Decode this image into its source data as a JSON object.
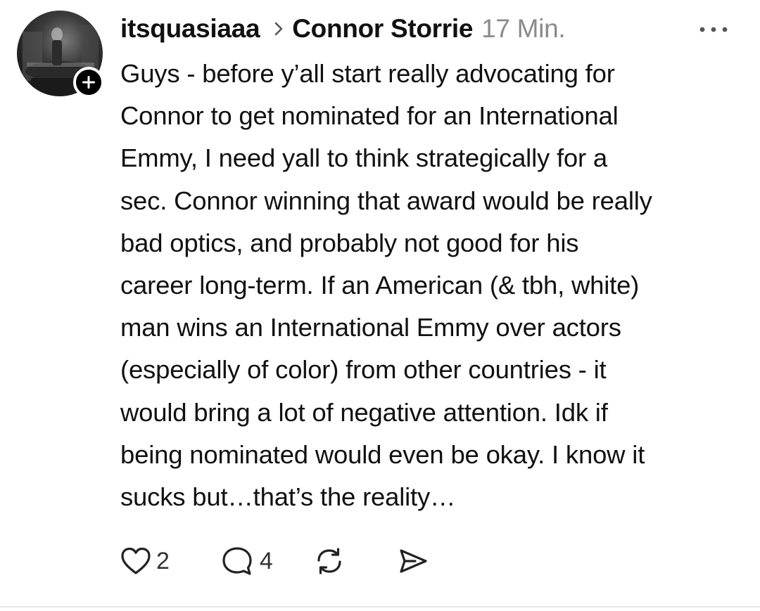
{
  "post": {
    "username": "itsquasiaaa",
    "reply_to": "Connor Storrie",
    "timestamp": "17 Min.",
    "body_lines": [
      "Guys - before y’all start really advocating for",
      "Connor to get nominated for an International",
      "Emmy, I need yall to think strategically for a",
      "sec. Connor winning that award would be really",
      "bad optics, and probably not good for his",
      "career long-term. If an American (& tbh, white)",
      "man wins an International Emmy over actors",
      "(especially of color) from other countries - it",
      "would bring a lot of negative attention. Idk if",
      "being nominated would even be okay. I know it",
      "sucks but…that’s the reality…"
    ],
    "actions": {
      "like_icon": "heart-icon",
      "like_count": "2",
      "comment_icon": "comment-icon",
      "comment_count": "4",
      "repost_icon": "repost-icon",
      "share_icon": "send-icon"
    },
    "follow_icon": "plus-icon",
    "more_icon": "more-horizontal-icon"
  },
  "colors": {
    "text": "#111111",
    "timestamp": "#8a8a8a",
    "divider": "#e6e6e6"
  }
}
